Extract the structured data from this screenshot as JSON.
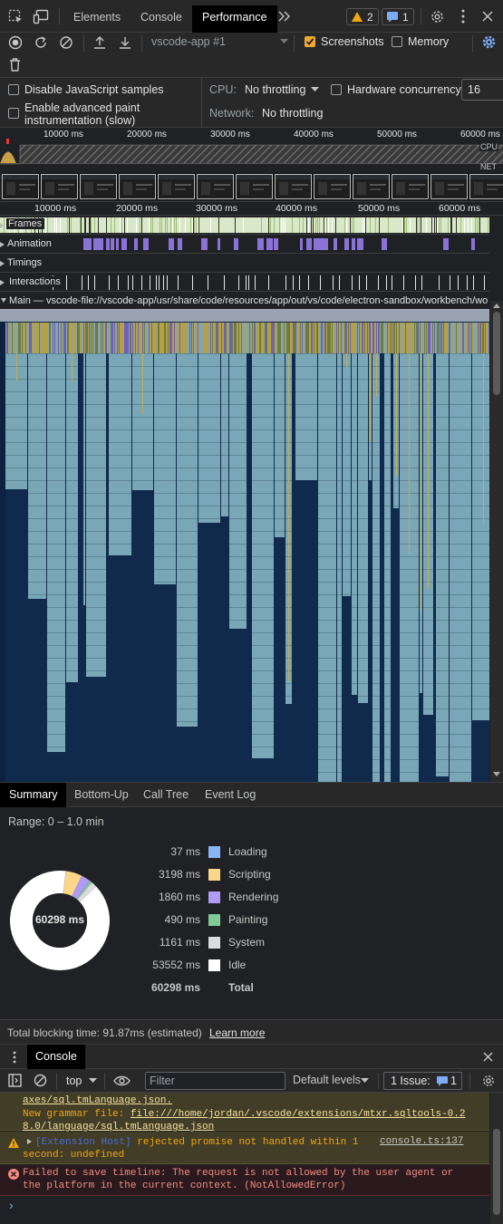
{
  "topbar": {
    "tabs": [
      "Elements",
      "Console",
      "Performance"
    ],
    "warnings": "2",
    "messages": "1"
  },
  "toolbar": {
    "recording": "vscode-app #1",
    "screenshots": "Screenshots",
    "memory": "Memory"
  },
  "settings": {
    "disable_js": "Disable JavaScript samples",
    "adv_paint": "Enable advanced paint instrumentation (slow)",
    "cpu_label": "CPU:",
    "cpu_value": "No throttling",
    "hw_label": "Hardware concurrency",
    "hw_value": "16",
    "net_label": "Network:",
    "net_value": "No throttling"
  },
  "overview": {
    "ticks": [
      "10000 ms",
      "20000 ms",
      "30000 ms",
      "40000 ms",
      "50000 ms",
      "60000 ms"
    ],
    "cpu": "CPU",
    "net": "NET"
  },
  "timeline": {
    "ticks": [
      "10000 ms",
      "20000 ms",
      "30000 ms",
      "40000 ms",
      "50000 ms",
      "60000 ms"
    ]
  },
  "tracks": {
    "frames": "Frames",
    "animation": "Animation",
    "timings": "Timings",
    "interactions": "Interactions",
    "main": "Main — vscode-file://vscode-app/usr/share/code/resources/app/out/vs/code/electron-sandbox/workbench/workbench.html"
  },
  "bottom_tabs": [
    "Summary",
    "Bottom-Up",
    "Call Tree",
    "Event Log"
  ],
  "summary": {
    "range": "Range: 0 – 1.0 min",
    "total_center": "60298 ms",
    "rows": [
      {
        "value": "37 ms",
        "label": "Loading",
        "color": "#8ab4f8"
      },
      {
        "value": "3198 ms",
        "label": "Scripting",
        "color": "#fdd688"
      },
      {
        "value": "1860 ms",
        "label": "Rendering",
        "color": "#af9af5"
      },
      {
        "value": "490 ms",
        "label": "Painting",
        "color": "#81c995"
      },
      {
        "value": "1161 ms",
        "label": "System",
        "color": "#dadce0"
      },
      {
        "value": "53552 ms",
        "label": "Idle",
        "color": "#ffffff"
      }
    ],
    "total_value": "60298 ms",
    "total_label": "Total",
    "blocking": "Total blocking time: 91.87ms (estimated)",
    "learn_more": "Learn more"
  },
  "drawer": {
    "console_tab": "Console",
    "context": "top",
    "filter_placeholder": "Filter",
    "levels": "Default levels",
    "issues": "1 Issue:",
    "issues_count": "1"
  },
  "console": {
    "line1": "axes/sql.tmLanguage.json.",
    "line2_prefix": "New grammar file: ",
    "line2_link": "file:///home/jordan/.vscode/extensions/mtxr.sqltools-0.28.0/language/sql.tmLanguage.json",
    "warn_tag": "[Extension Host]",
    "warn_text": " rejected promise not handled within 1 second: undefined",
    "warn_src": "console.ts:137",
    "error": "Failed to save timeline: The request is not allowed by the user agent or the platform in the current context. (NotAllowedError)",
    "prompt": "›"
  }
}
